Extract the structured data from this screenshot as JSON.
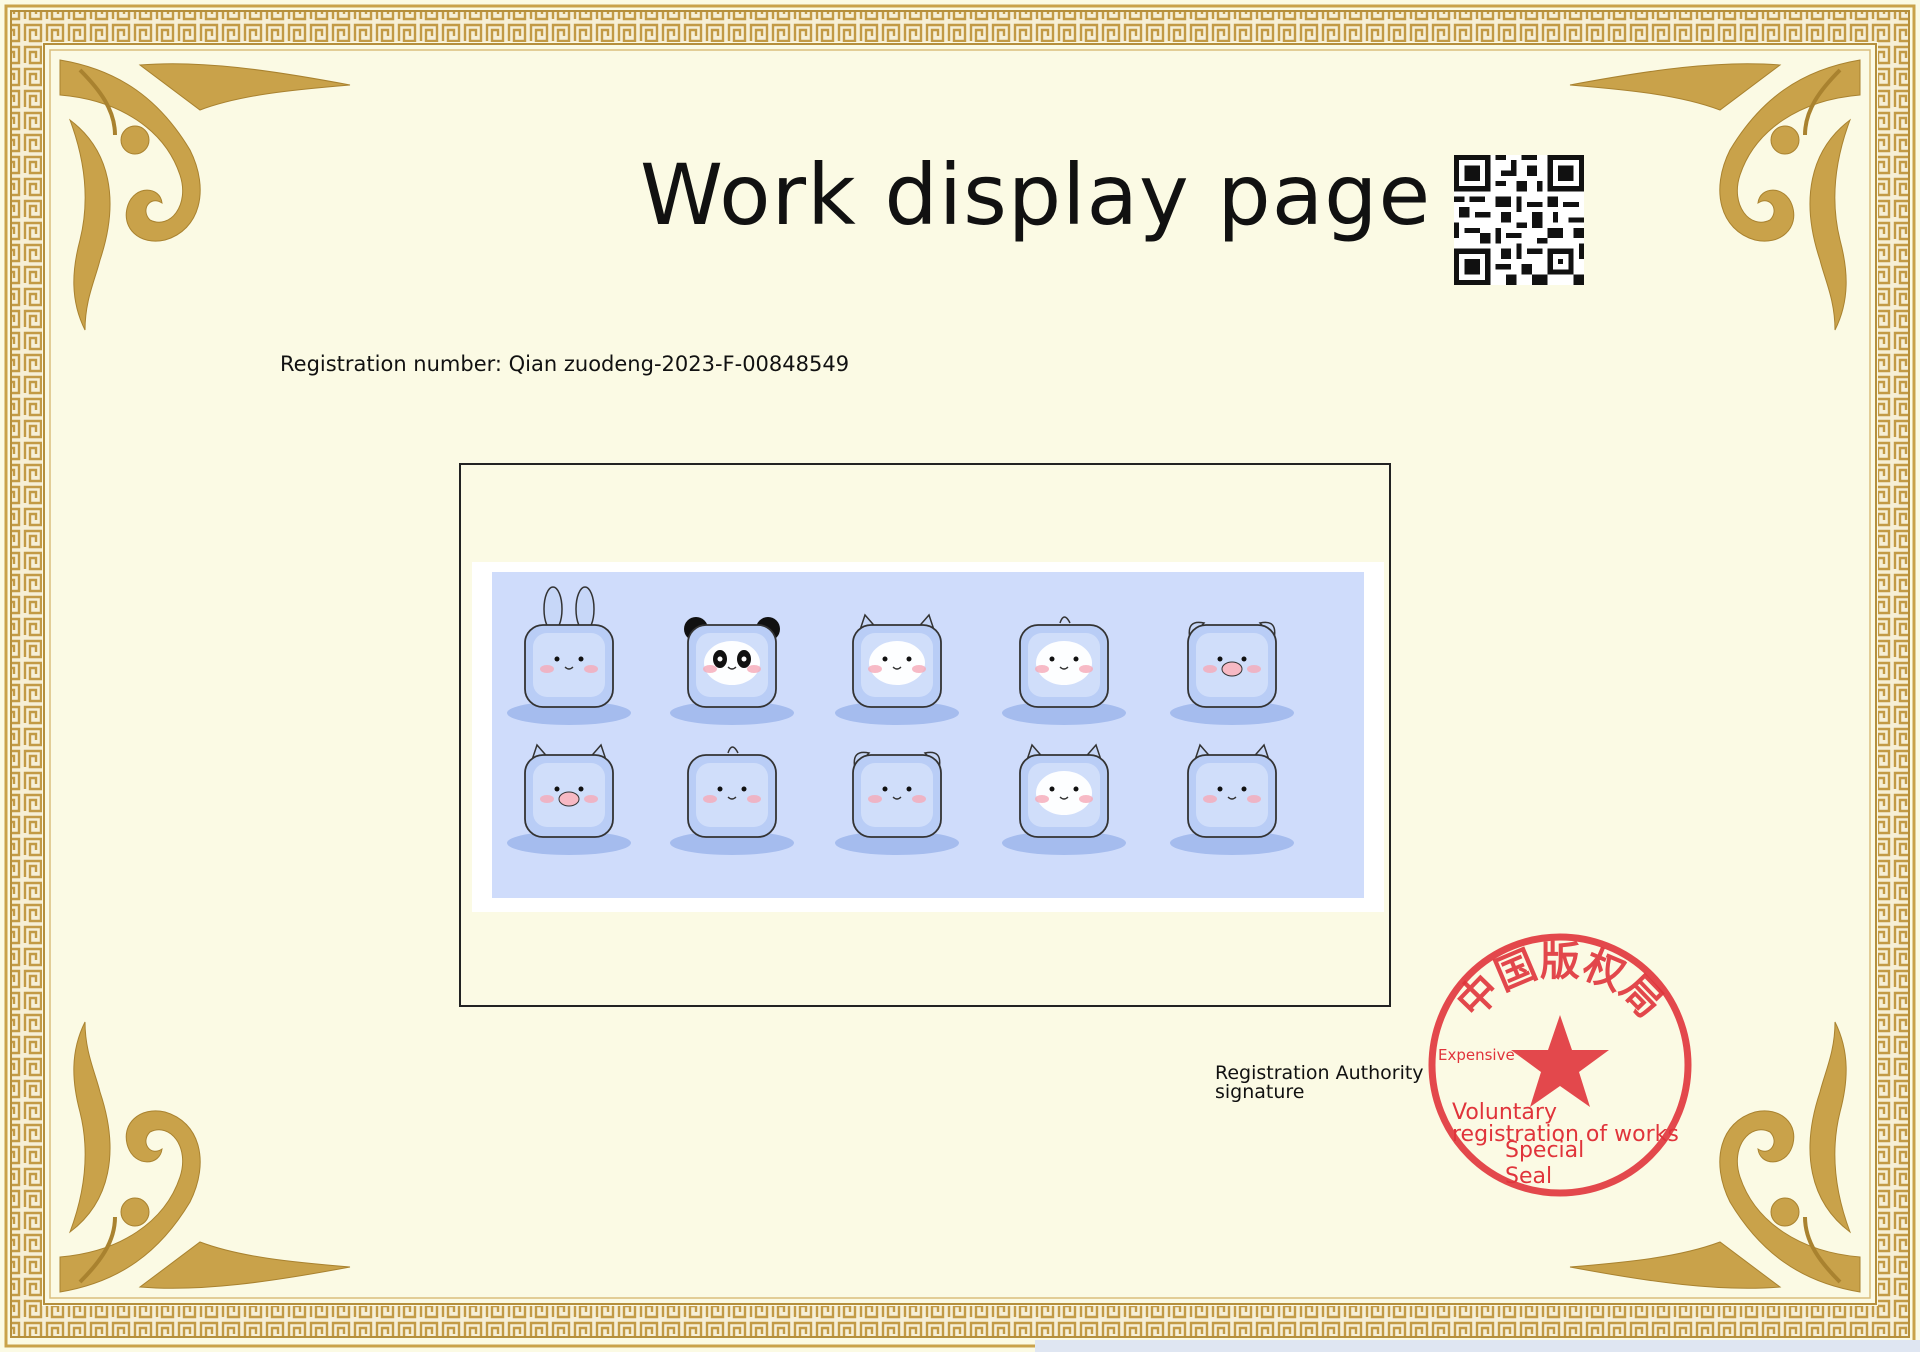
{
  "title": "Work display page",
  "registration_number": "Registration number: Qian zuodeng-2023-F-00848549",
  "signature_label_line1": "Registration Authority",
  "signature_label_line2": "signature",
  "seal": {
    "top_text": "中国版权局",
    "small_text": "Expensive",
    "line1": "Voluntary",
    "line2": "registration of works",
    "line3": "Special",
    "line4": "Seal"
  },
  "artwork": {
    "description_icons": [
      "rabbit-bag",
      "panda-bag",
      "sheep-bag",
      "penguin-bag",
      "pig-bag",
      "cow-bag",
      "chick-bag",
      "dog-bag",
      "seal-bag",
      "cat-bag"
    ]
  },
  "colors": {
    "background": "#fbfae4",
    "gold": "#c9a24a",
    "seal_red": "#e0343b",
    "artwork_bg": "#cfdcfb",
    "bag_blue": "#b9cdf6"
  }
}
